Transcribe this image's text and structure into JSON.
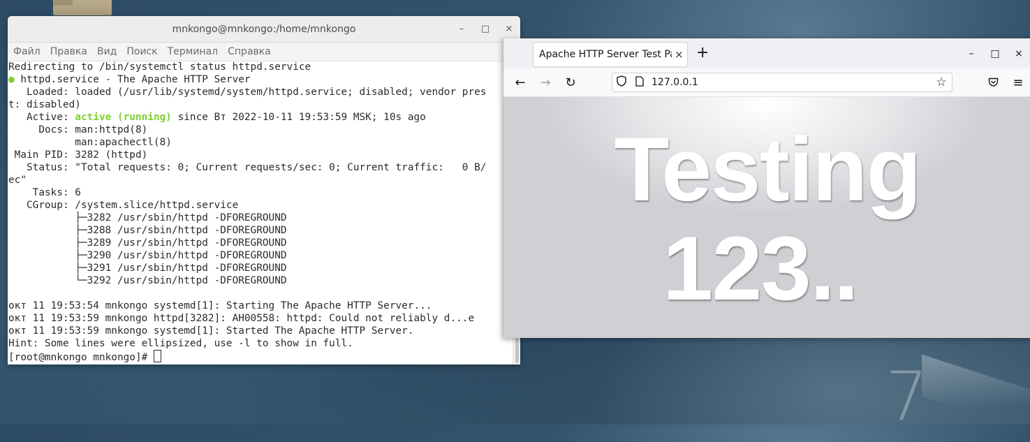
{
  "desktop": {
    "watermark": "7"
  },
  "terminal": {
    "title": "mnkongo@mnkongo:/home/mnkongo",
    "window_buttons": [
      "–",
      "□",
      "×"
    ],
    "menu": [
      "Файл",
      "Правка",
      "Вид",
      "Поиск",
      "Терминал",
      "Справка"
    ],
    "lines": [
      "Redirecting to /bin/systemctl status httpd.service",
      " httpd.service - The Apache HTTP Server",
      "   Loaded: loaded (/usr/lib/systemd/system/httpd.service; disabled; vendor pres",
      "t: disabled)",
      "   Active: ",
      "     Docs: man:httpd(8)",
      "           man:apachectl(8)",
      " Main PID: 3282 (httpd)",
      "   Status: \"Total requests: 0; Current requests/sec: 0; Current traffic:   0 B/",
      "ec\"",
      "    Tasks: 6",
      "   CGroup: /system.slice/httpd.service",
      "           ├─3282 /usr/sbin/httpd -DFOREGROUND",
      "           ├─3288 /usr/sbin/httpd -DFOREGROUND",
      "           ├─3289 /usr/sbin/httpd -DFOREGROUND",
      "           ├─3290 /usr/sbin/httpd -DFOREGROUND",
      "           ├─3291 /usr/sbin/httpd -DFOREGROUND",
      "           └─3292 /usr/sbin/httpd -DFOREGROUND",
      "",
      "окт 11 19:53:54 mnkongo systemd[1]: Starting The Apache HTTP Server...",
      "окт 11 19:53:59 mnkongo httpd[3282]: AH00558: httpd: Could not reliably d...e",
      "окт 11 19:53:59 mnkongo systemd[1]: Started The Apache HTTP Server.",
      "Hint: Some lines were ellipsized, use -l to show in full.",
      "[root@mnkongo mnkongo]# "
    ],
    "status_dot": "●",
    "active_state": "active (running)",
    "active_rest": " since Вт 2022-10-11 19:53:59 MSK; 10s ago"
  },
  "browser": {
    "tab_title": "Apache HTTP Server Test Page",
    "tab_close": "×",
    "new_tab": "+",
    "window_buttons": [
      "–",
      "□",
      "×"
    ],
    "url": "127.0.0.1",
    "page_heading_line1": "Testing",
    "page_heading_line2": "123.."
  },
  "colors": {
    "status_green": "#7dd12f",
    "terminal_bg": "#ffffff",
    "browser_chrome": "#f0f0f4"
  }
}
